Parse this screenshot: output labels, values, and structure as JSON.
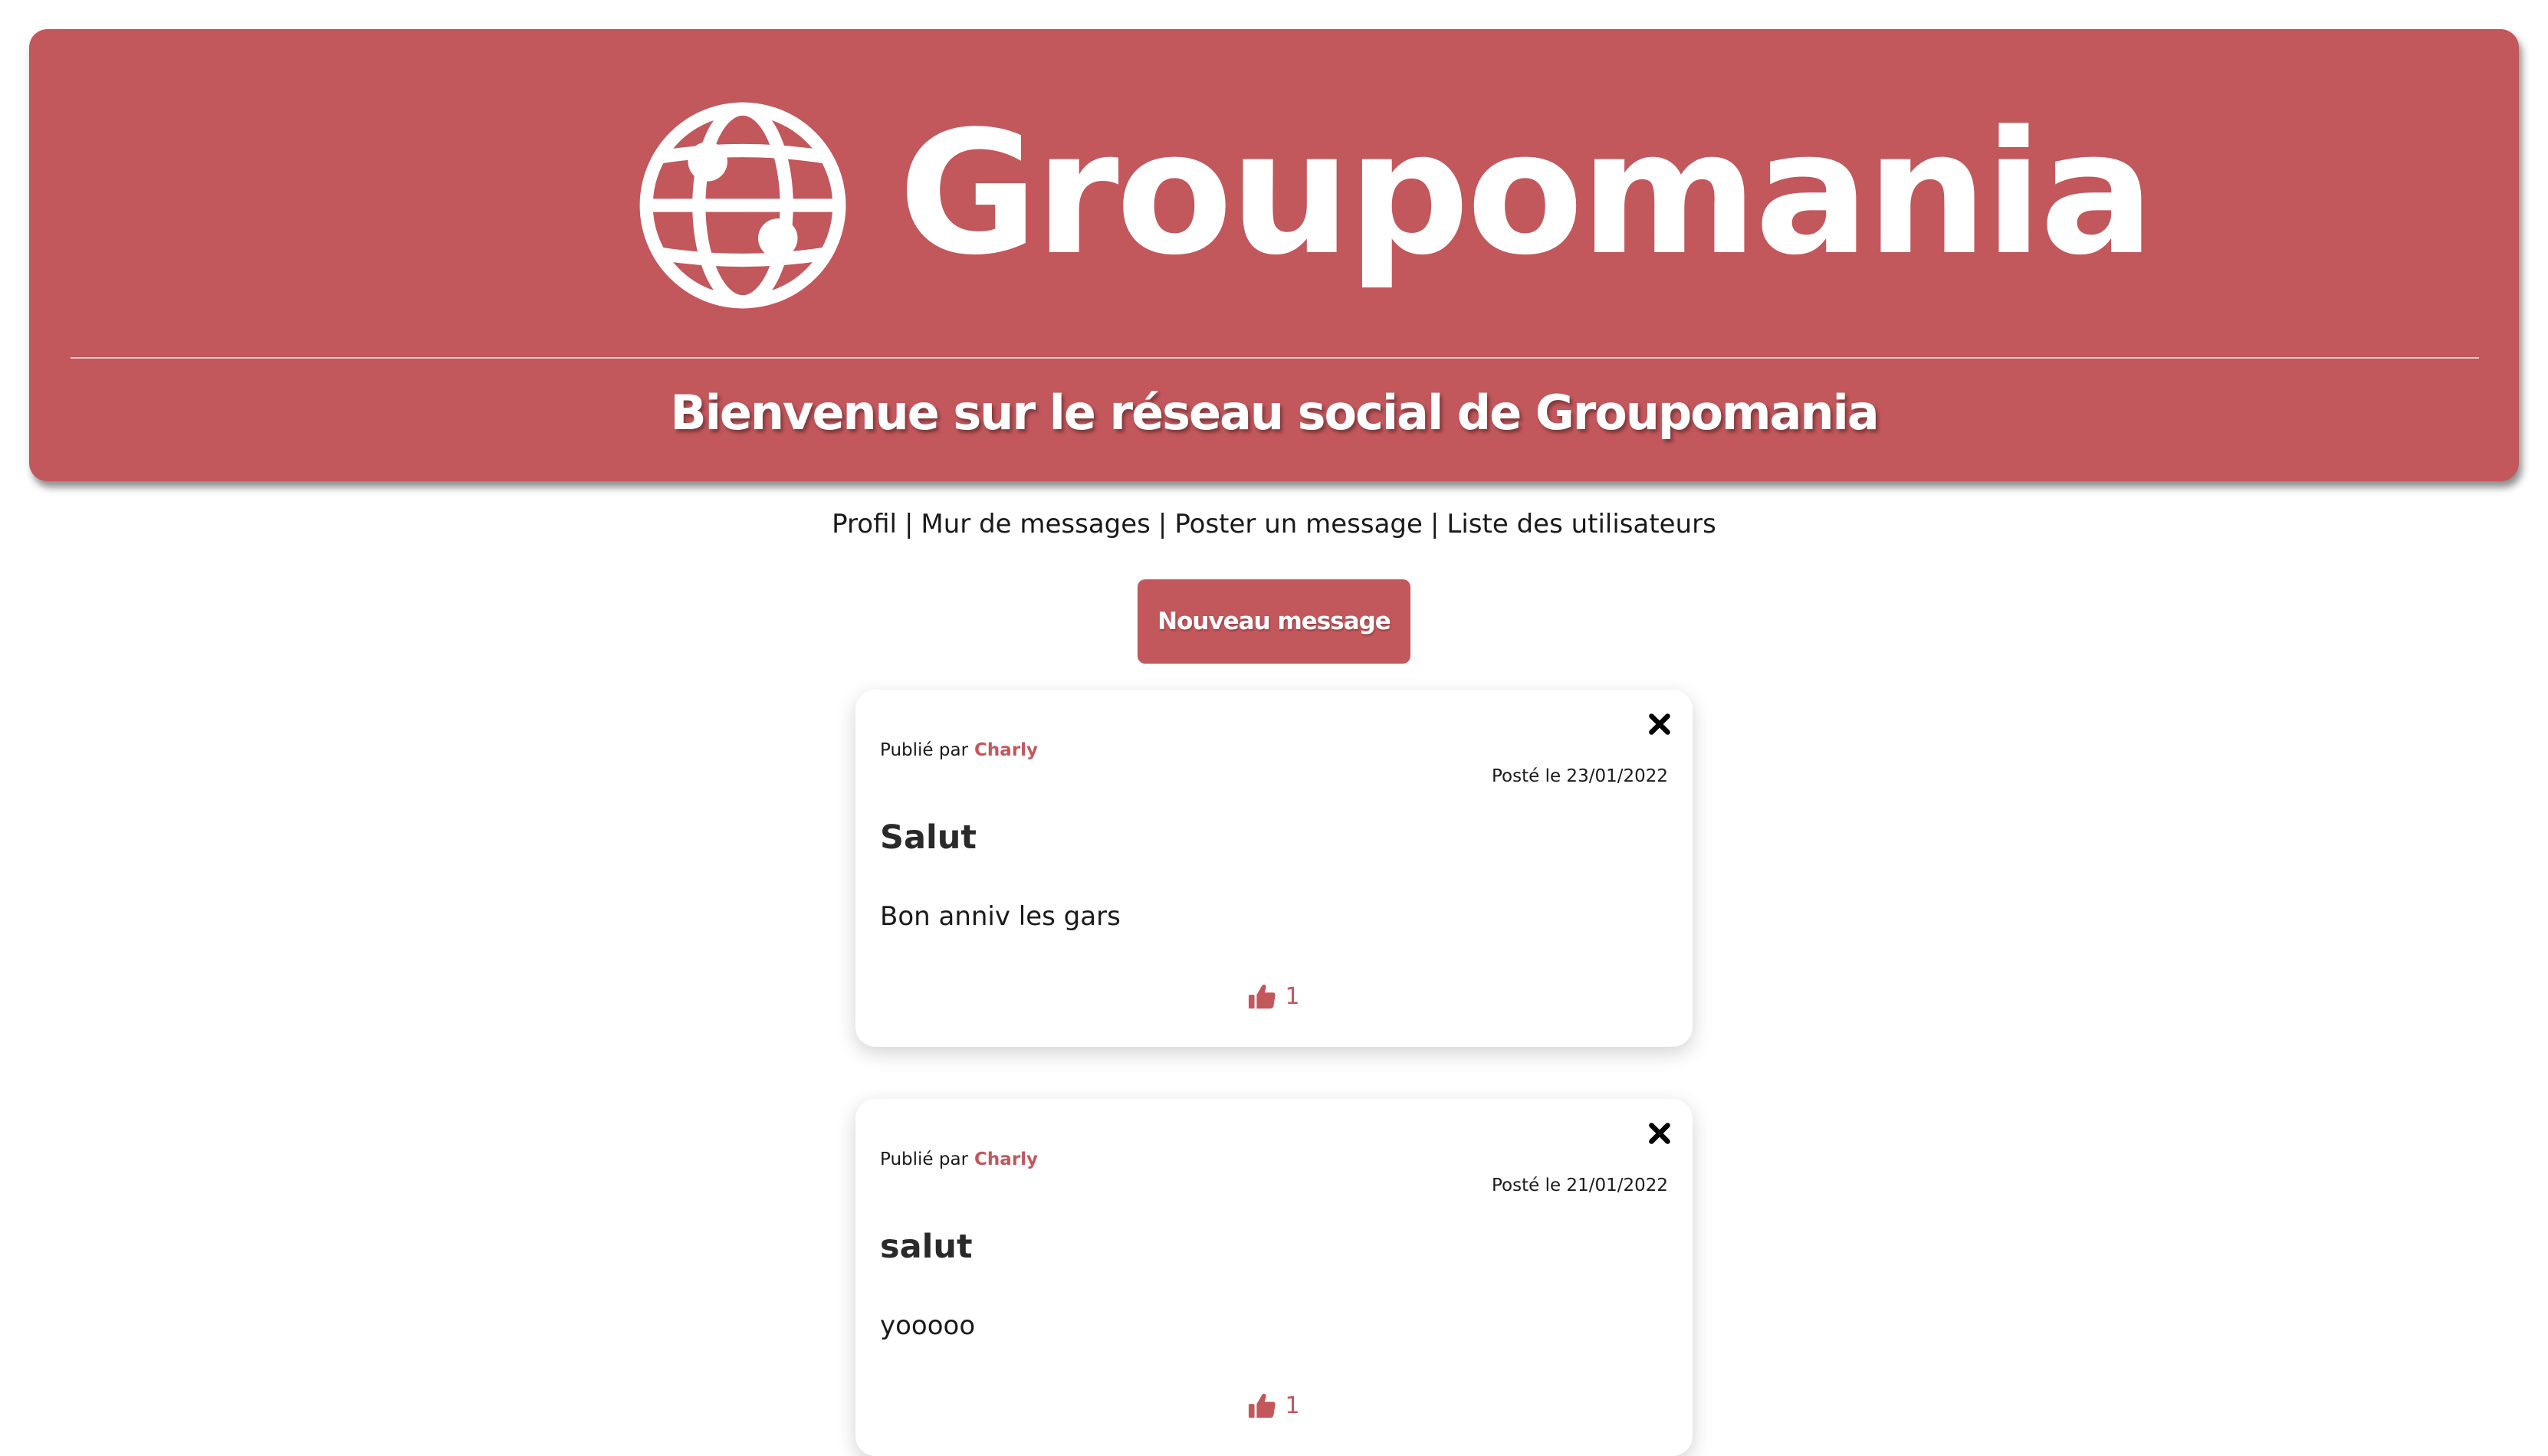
{
  "header": {
    "logo_text": "Groupomania",
    "subtitle": "Bienvenue sur le réseau social de Groupomania"
  },
  "nav": {
    "items": [
      {
        "label": "Profil"
      },
      {
        "label": "Mur de messages"
      },
      {
        "label": "Poster un message"
      },
      {
        "label": "Liste des utilisateurs"
      }
    ],
    "separator": "|"
  },
  "new_message_button": "Nouveau message",
  "posts": [
    {
      "published_by_label": "Publié par",
      "author": "Charly",
      "date": "Posté le 23/01/2022",
      "title": "Salut",
      "body": "Bon anniv les gars",
      "likes": "1"
    },
    {
      "published_by_label": "Publié par",
      "author": "Charly",
      "date": "Posté le 21/01/2022",
      "title": "salut",
      "body": "yooooo",
      "likes": "1"
    }
  ],
  "colors": {
    "brand": "#c2575c",
    "text": "#1a1a1a"
  }
}
